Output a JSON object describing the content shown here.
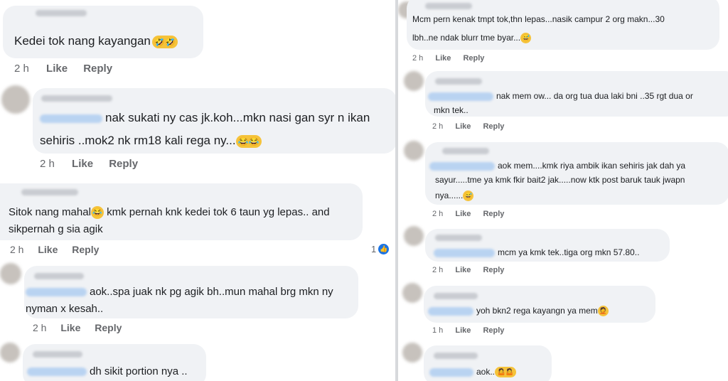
{
  "left_comments": [
    {
      "line1": "Kedei tok nang kayangan",
      "emoji": "🤣🤣",
      "time": "2 h",
      "like": "Like",
      "reply": "Reply"
    },
    {
      "line1": "nak sukati ny cas jk.koh...mkn nasi gan syr n ikan",
      "line2": "sehiris ..mok2 nk rm18 kali rega ny...",
      "emoji": "😂😂",
      "time": "2 h",
      "like": "Like",
      "reply": "Reply"
    },
    {
      "line1a": "Sitok nang mahal",
      "emoji": "😂",
      "line1b": " kmk pernah knk kedei tok 6 taun yg lepas.. and",
      "line2": "sikpernah g sia agik",
      "time": "2 h",
      "like": "Like",
      "reply": "Reply",
      "reactions": "1"
    },
    {
      "line1": "aok..spa juak nk pg agik bh..mun mahal brg mkn ny",
      "line2": "nyman x kesah..",
      "time": "2 h",
      "like": "Like",
      "reply": "Reply"
    },
    {
      "line1": "dh sikit portion nya .."
    }
  ],
  "right_comments": [
    {
      "line1": "Mcm pern kenak tmpt tok,thn lepas...nasik campur 2 org makn...30",
      "line2": "lbh..ne ndak blurr tme byar...",
      "emoji": "😅",
      "time": "2 h",
      "like": "Like",
      "reply": "Reply"
    },
    {
      "line1": "nak mem ow... da org tua dua laki bni ..35 rgt dua or",
      "line2": "mkn tek..",
      "time": "2 h",
      "like": "Like",
      "reply": "Reply"
    },
    {
      "line1": "aok mem....kmk riya ambik ikan sehiris jak dah ya",
      "line2": "sayur.....tme ya kmk fkir bait2 jak.....now ktk post baruk tauk jwapn",
      "line3": "nya......",
      "emoji": "😅",
      "time": "2 h",
      "like": "Like",
      "reply": "Reply"
    },
    {
      "line1": "mcm ya kmk tek..tiga org mkn 57.80..",
      "time": "2 h",
      "like": "Like",
      "reply": "Reply"
    },
    {
      "line1": "yoh bkn2 rega kayangn ya mem",
      "emoji": "🤦",
      "time": "1 h",
      "like": "Like",
      "reply": "Reply"
    },
    {
      "line1": "aok..",
      "emoji": "🤷🤷"
    }
  ],
  "icons": {
    "like_badge": "thumbs-up-icon"
  },
  "colors": {
    "bubble": "#f0f2f5",
    "meta_text": "#65676b",
    "like_blue": "#1b74e4"
  }
}
